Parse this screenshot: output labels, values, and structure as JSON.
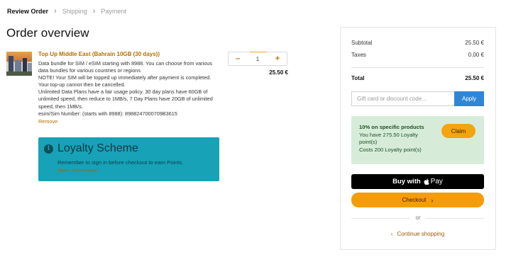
{
  "breadcrumb": {
    "items": [
      "Review Order",
      "Shipping",
      "Payment"
    ],
    "separator": "›"
  },
  "page_title": "Order overview",
  "product": {
    "title": "Top Up Middle East (Bahrain 10GB (30 days))",
    "description": "Data bundle for SIM / eSIM starting with 8988. You can choose from various data bundles for various countries or regions",
    "note": "NOTE! Your SIM will be topped up immediately after payment is completed. Your top-up cannot then be cancelled.",
    "policy": "Unlimited Data Plans have a fair usage policy. 30 day plans have 60GB of unlimited speed, then reduce to 1MB/s, 7 Day Plans have 20GB of unlimited speed, then 1MB/s.",
    "sim_number": "esim/Sim Number: (starts with 8988): 8988247000709B3615",
    "remove_label": "Remove",
    "quantity": "1",
    "decrement_label": "–",
    "increment_label": "+",
    "price": "25.50 €"
  },
  "loyalty": {
    "icon_glyph": "i",
    "heading": "Loyalty Scheme",
    "message": "Remember to sign in before checkout to earn Points.",
    "more_link": "More information."
  },
  "summary": {
    "subtotal_label": "Subtotal",
    "subtotal_value": "25.50 €",
    "taxes_label": "Taxes",
    "taxes_value": "0.00 €",
    "total_label": "Total",
    "total_value": "25.50 €",
    "discount_placeholder": "Gift card or discount code...",
    "apply_label": "Apply",
    "promo": {
      "title": "10% on specific products",
      "line1": "You have 275.50 Loyalty",
      "line2": "point(s)",
      "line3": "Costs 200 Loyalty point(s)",
      "claim_label": "Claim"
    },
    "applepay_label": "Buy with",
    "applepay_pay": "Pay",
    "checkout_label": "Checkout",
    "checkout_arrow": "›",
    "or_label": "or",
    "continue_chevron": "‹",
    "continue_label": "Continue shopping"
  },
  "colors": {
    "accent_orange": "#f59c0b",
    "loyalty_teal": "#17a2b8",
    "apply_blue": "#2f86d6",
    "promo_green": "#d6ecd9"
  }
}
